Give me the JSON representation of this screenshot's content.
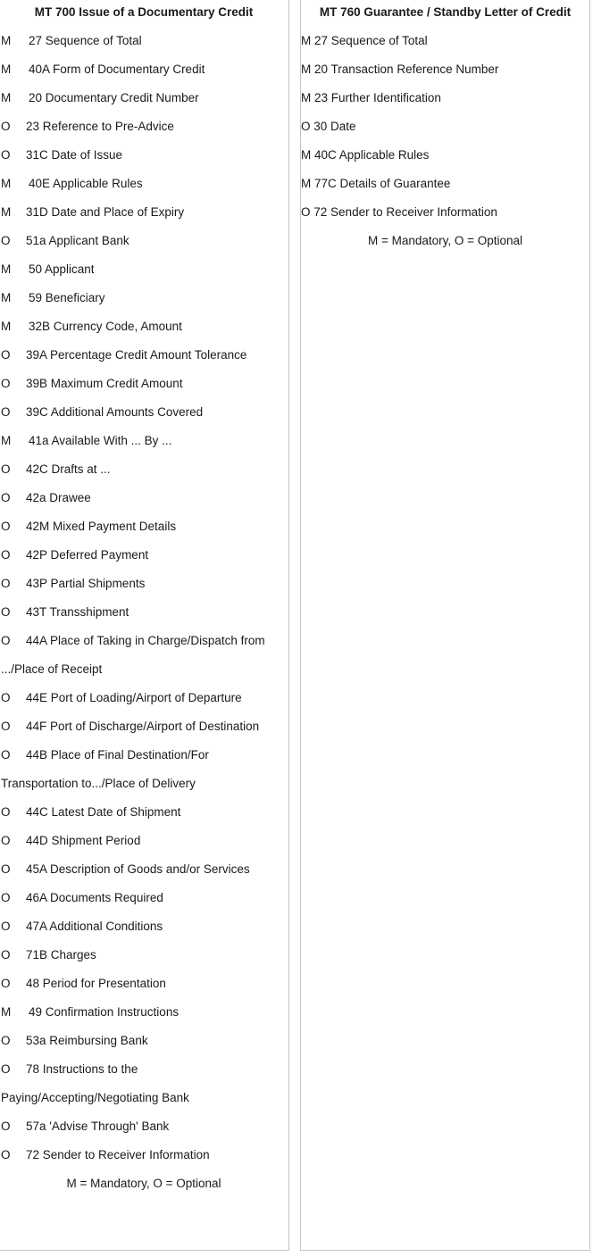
{
  "left": {
    "title": "MT 700 Issue of a Documentary Credit",
    "rows": [
      {
        "flag": "M",
        "text": "27 Sequence of Total"
      },
      {
        "flag": "M",
        "text": "40A Form of Documentary Credit"
      },
      {
        "flag": "M",
        "text": "20 Documentary Credit Number"
      },
      {
        "flag": "O",
        "text": "23 Reference to Pre-Advice"
      },
      {
        "flag": "O",
        "text": "31C Date of Issue"
      },
      {
        "flag": "M",
        "text": "40E Applicable Rules"
      },
      {
        "flag": "M",
        "text": "31D Date and Place of Expiry",
        "tight": true
      },
      {
        "flag": "O",
        "text": "51a Applicant Bank"
      },
      {
        "flag": "M",
        "text": "50 Applicant"
      },
      {
        "flag": "M",
        "text": "59 Beneficiary"
      },
      {
        "flag": "M",
        "text": "32B Currency Code, Amount"
      },
      {
        "flag": "O",
        "text": "39A Percentage Credit Amount Tolerance"
      },
      {
        "flag": "O",
        "text": "39B Maximum Credit Amount"
      },
      {
        "flag": "O",
        "text": "39C Additional Amounts Covered"
      },
      {
        "flag": "M",
        "text": "41a Available With ... By ..."
      },
      {
        "flag": "O",
        "text": "42C Drafts at ..."
      },
      {
        "flag": "O",
        "text": "42a Drawee"
      },
      {
        "flag": "O",
        "text": "42M Mixed Payment Details"
      },
      {
        "flag": "O",
        "text": "42P Deferred Payment"
      },
      {
        "flag": "O",
        "text": "43P Partial Shipments"
      },
      {
        "flag": "O",
        "text": "43T Transshipment"
      },
      {
        "flag": "O",
        "text": "44A Place of Taking in Charge/Dispatch from",
        "cont": ".../Place of Receipt"
      },
      {
        "flag": "O",
        "text": "44E Port of Loading/Airport of Departure"
      },
      {
        "flag": "O",
        "text": "44F Port of Discharge/Airport of Destination"
      },
      {
        "flag": "O",
        "text": "44B Place of Final Destination/For",
        "cont": "Transportation to.../Place of Delivery"
      },
      {
        "flag": "O",
        "text": "44C Latest Date of Shipment"
      },
      {
        "flag": "O",
        "text": "44D Shipment Period"
      },
      {
        "flag": "O",
        "text": "45A Description of Goods and/or Services"
      },
      {
        "flag": "O",
        "text": "46A Documents Required"
      },
      {
        "flag": "O",
        "text": "47A Additional Conditions"
      },
      {
        "flag": "O",
        "text": "71B Charges"
      },
      {
        "flag": "O",
        "text": "48 Period for Presentation"
      },
      {
        "flag": "M",
        "text": "49 Confirmation Instructions"
      },
      {
        "flag": "O",
        "text": "53a Reimbursing Bank"
      },
      {
        "flag": "O",
        "text": "78 Instructions to the",
        "cont": "Paying/Accepting/Negotiating Bank"
      },
      {
        "flag": "O",
        "text": "57a 'Advise Through' Bank"
      },
      {
        "flag": "O",
        "text": "72 Sender to Receiver Information"
      }
    ],
    "legend": "M = Mandatory, O = Optional"
  },
  "right": {
    "title": "MT 760 Guarantee / Standby Letter of Credit",
    "rows": [
      {
        "flag": "M",
        "text": "27 Sequence of Total"
      },
      {
        "flag": "M",
        "text": "20 Transaction Reference Number"
      },
      {
        "flag": "M",
        "text": "23 Further Identification"
      },
      {
        "flag": "O",
        "text": "30 Date"
      },
      {
        "flag": "M",
        "text": "40C Applicable Rules"
      },
      {
        "flag": "M",
        "text": "77C Details of Guarantee"
      },
      {
        "flag": "O",
        "text": "72 Sender to Receiver Information"
      }
    ],
    "legend": "M = Mandatory, O = Optional"
  }
}
